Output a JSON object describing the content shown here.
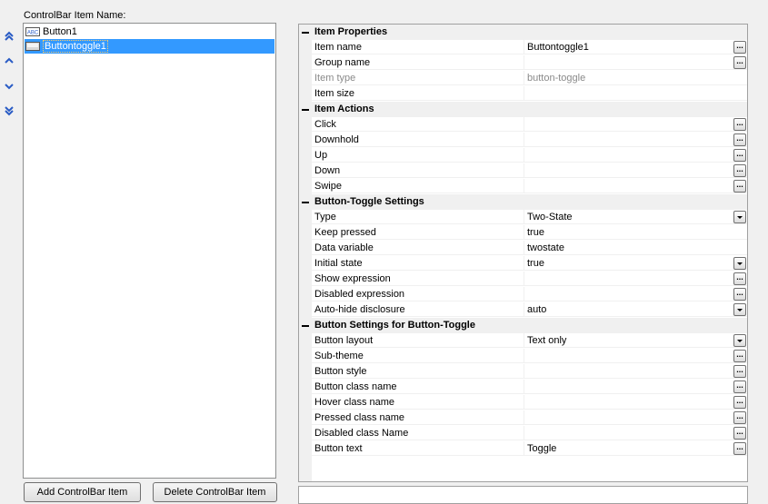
{
  "panel_label": "ControlBar Item Name:",
  "list_items": [
    {
      "label": "Button1",
      "icon": "button-abc-icon",
      "selected": false
    },
    {
      "label": "Buttontoggle1",
      "icon": "toggle-icon",
      "selected": true
    }
  ],
  "buttons": {
    "add": "Add ControlBar Item",
    "delete": "Delete ControlBar Item"
  },
  "grid": {
    "sections": [
      {
        "title": "Item Properties",
        "rows": [
          {
            "name": "Item name",
            "value": "Buttontoggle1",
            "editor": "ellipsis",
            "readonly": false
          },
          {
            "name": "Group name",
            "value": "",
            "editor": "ellipsis",
            "readonly": false
          },
          {
            "name": "Item type",
            "value": "button-toggle",
            "editor": "none",
            "readonly": true
          },
          {
            "name": "Item size",
            "value": "",
            "editor": "none",
            "readonly": false
          }
        ]
      },
      {
        "title": "Item Actions",
        "rows": [
          {
            "name": "Click",
            "value": "",
            "editor": "ellipsis",
            "readonly": false
          },
          {
            "name": "Downhold",
            "value": "",
            "editor": "ellipsis",
            "readonly": false
          },
          {
            "name": "Up",
            "value": "",
            "editor": "ellipsis",
            "readonly": false
          },
          {
            "name": "Down",
            "value": "",
            "editor": "ellipsis",
            "readonly": false
          },
          {
            "name": "Swipe",
            "value": "",
            "editor": "ellipsis",
            "readonly": false
          }
        ]
      },
      {
        "title": "Button-Toggle Settings",
        "rows": [
          {
            "name": "Type",
            "value": "Two-State",
            "editor": "dropdown",
            "readonly": false
          },
          {
            "name": "Keep pressed",
            "value": "true",
            "editor": "none",
            "readonly": false
          },
          {
            "name": "Data variable",
            "value": "twostate",
            "editor": "none",
            "readonly": false
          },
          {
            "name": "Initial state",
            "value": "true",
            "editor": "dropdown",
            "readonly": false
          },
          {
            "name": "Show expression",
            "value": "",
            "editor": "ellipsis",
            "readonly": false
          },
          {
            "name": "Disabled expression",
            "value": "",
            "editor": "ellipsis",
            "readonly": false
          },
          {
            "name": "Auto-hide disclosure",
            "value": "auto",
            "editor": "dropdown",
            "readonly": false
          }
        ]
      },
      {
        "title": "Button Settings for Button-Toggle",
        "rows": [
          {
            "name": "Button layout",
            "value": "Text only",
            "editor": "dropdown",
            "readonly": false
          },
          {
            "name": "Sub-theme",
            "value": "",
            "editor": "ellipsis",
            "readonly": false
          },
          {
            "name": "Button style",
            "value": "",
            "editor": "ellipsis",
            "readonly": false
          },
          {
            "name": "Button class name",
            "value": "",
            "editor": "ellipsis",
            "readonly": false
          },
          {
            "name": "Hover class name",
            "value": "",
            "editor": "ellipsis",
            "readonly": false
          },
          {
            "name": "Pressed class name",
            "value": "",
            "editor": "ellipsis",
            "readonly": false
          },
          {
            "name": "Disabled class Name",
            "value": "",
            "editor": "ellipsis",
            "readonly": false
          },
          {
            "name": "Button text",
            "value": "Toggle",
            "editor": "ellipsis",
            "readonly": false
          }
        ]
      }
    ]
  },
  "colors": {
    "selection": "#3399ff",
    "arrow_blue": "#2a5cc5",
    "category_bg": "#f0f0f0",
    "readonly_text": "#8a8a8a"
  }
}
